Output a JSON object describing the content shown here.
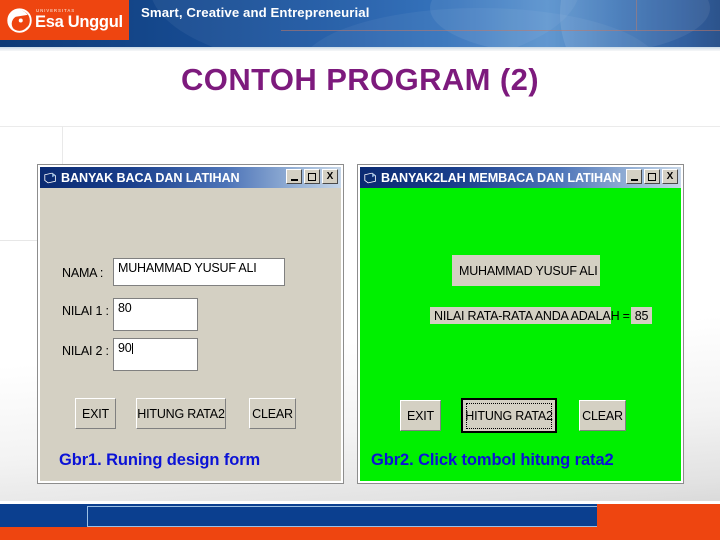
{
  "header": {
    "logo_supertext": "UNIVERSITAS",
    "logo_name": "Esa Unggul",
    "logo_icon": "esa-unggul-swirl-logo",
    "tagline": "Smart, Creative and Entrepreneurial"
  },
  "slide": {
    "title": "CONTOH  PROGRAM (2)",
    "title_color": "#7d1a7d"
  },
  "window_left": {
    "title": "BANYAK BACA DAN LATIHAN",
    "app_icon": "vb-form-icon",
    "titlebar_buttons": [
      {
        "name": "minimize",
        "label": "_"
      },
      {
        "name": "maximize",
        "label": "□"
      },
      {
        "name": "close",
        "label": "X"
      }
    ],
    "fields": [
      {
        "label": "NAMA  :",
        "value": "MUHAMMAD  YUSUF  ALI"
      },
      {
        "label": "NILAI 1 :",
        "value": "80"
      },
      {
        "label": "NILAI 2 :",
        "value": "90"
      }
    ],
    "buttons": [
      {
        "label": "EXIT",
        "focused": false
      },
      {
        "label": "HITUNG  RATA2",
        "focused": false
      },
      {
        "label": "CLEAR",
        "focused": false
      }
    ],
    "caption": "Gbr1. Runing design form",
    "background": "#d4d0c3"
  },
  "window_right": {
    "title": "BANYAK2LAH MEMBACA DAN LATIHAN",
    "app_icon": "vb-form-icon",
    "titlebar_buttons": [
      {
        "name": "minimize",
        "label": "_"
      },
      {
        "name": "maximize",
        "label": "□"
      },
      {
        "name": "close",
        "label": "X"
      }
    ],
    "name_output": "MUHAMMAD  YUSUF  ALI",
    "result_label": "NILAI RATA-RATA ANDA ADALAH =",
    "result_value": "85",
    "buttons": [
      {
        "label": "EXIT",
        "focused": false
      },
      {
        "label": "HITUNG RATA2",
        "focused": true
      },
      {
        "label": "CLEAR",
        "focused": false
      }
    ],
    "caption": "Gbr2. Click tombol hitung rata2",
    "background": "#00f000"
  },
  "colors": {
    "brand_orange": "#ee4510",
    "brand_blue": "#0b3f8f",
    "caption_blue": "#0b12d6",
    "title_purple": "#7d1a7d",
    "form_gray": "#d4d0c3",
    "form_green": "#00f000"
  }
}
